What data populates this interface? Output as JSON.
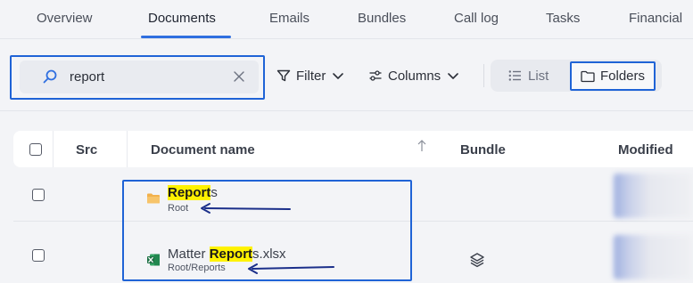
{
  "tabs": [
    {
      "label": "Overview",
      "active": false
    },
    {
      "label": "Documents",
      "active": true
    },
    {
      "label": "Emails",
      "active": false
    },
    {
      "label": "Bundles",
      "active": false
    },
    {
      "label": "Call log",
      "active": false
    },
    {
      "label": "Tasks",
      "active": false
    },
    {
      "label": "Financial",
      "active": false
    }
  ],
  "toolbar": {
    "search": {
      "value": "report",
      "placeholder": ""
    },
    "filter_label": "Filter",
    "columns_label": "Columns",
    "view_list_label": "List",
    "view_folders_label": "Folders",
    "active_view": "Folders"
  },
  "table": {
    "columns": {
      "src": "Src",
      "name": "Document name",
      "bundle": "Bundle",
      "modified": "Modified"
    },
    "rows": [
      {
        "type": "folder",
        "name_match": "Report",
        "name_rest": "s",
        "name_prefix": "",
        "path": "Root",
        "has_bundle": false
      },
      {
        "type": "xlsx",
        "name_prefix": "Matter ",
        "name_match": "Report",
        "name_rest": "s.xlsx",
        "path": "Root/Reports",
        "has_bundle": true
      }
    ]
  },
  "colors": {
    "accent": "#2f6fe0",
    "annotation_box": "#1f63d6",
    "annotation_arrow": "#1b2f8a",
    "search_highlight": "#fff200",
    "folder": "#f2b14c",
    "excel": "#1e7145"
  },
  "icons": [
    "search-icon",
    "clear-icon",
    "filter-icon",
    "columns-icon",
    "chevron-down-icon",
    "list-icon",
    "folder-icon",
    "sort-arrow-icon",
    "folder-icon",
    "excel-icon",
    "bundle-layers-icon"
  ]
}
